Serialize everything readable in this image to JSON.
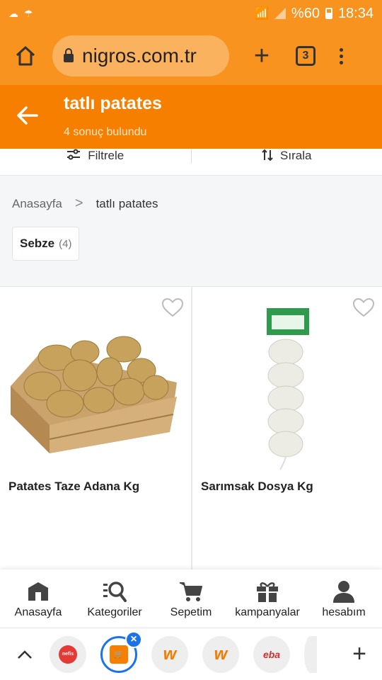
{
  "status_bar": {
    "battery": "%60",
    "time": "18:34"
  },
  "browser": {
    "url": "nigros.com.tr",
    "tab_count": "3"
  },
  "header": {
    "title": "tatlı patates",
    "subtitle": "4 sonuç bulundu"
  },
  "filters": {
    "filter_label": "Filtrele",
    "sort_label": "Sırala"
  },
  "breadcrumb": {
    "home": "Anasayfa",
    "separator": ">",
    "current": "tatlı patates"
  },
  "category_chip": {
    "label": "Sebze",
    "count": "(4)"
  },
  "products": [
    {
      "name": "Patates Taze Adana Kg"
    },
    {
      "name": "Sarımsak Dosya Kg"
    }
  ],
  "bottom_nav": {
    "items": [
      {
        "label": "Anasayfa"
      },
      {
        "label": "Kategoriler"
      },
      {
        "label": "Sepetim"
      },
      {
        "label": "kampanyalar"
      },
      {
        "label": "hesabım"
      }
    ]
  },
  "tab_bar": {
    "tabs": [
      {
        "text": "nefis",
        "color": "#e53935"
      },
      {
        "text": "",
        "color": "#f77f00"
      },
      {
        "text": "w",
        "color": "#f57c00"
      },
      {
        "text": "w",
        "color": "#f57c00"
      },
      {
        "text": "eba",
        "color": "#d32f2f"
      }
    ]
  },
  "colors": {
    "brand": "#f77f00",
    "browser": "#f7931e",
    "accent": "#1a73e8"
  }
}
